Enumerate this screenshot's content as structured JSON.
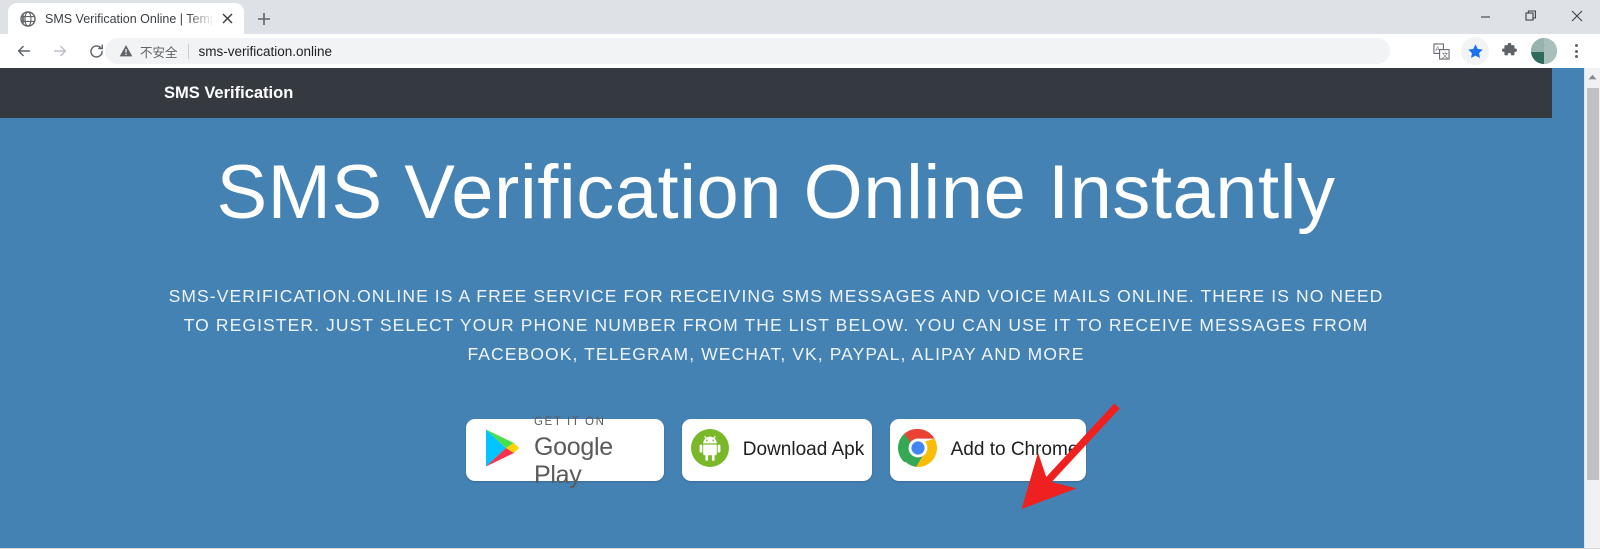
{
  "browser": {
    "tab": {
      "title": "SMS Verification Online | Temp",
      "favicon_icon": "globe-icon",
      "close_icon": "close-icon"
    },
    "new_tab_label": "+",
    "window_controls": {
      "minimize": "minimize-icon",
      "maximize": "restore-icon",
      "close": "close-icon"
    },
    "nav": {
      "back_icon": "back-arrow-icon",
      "forward_icon": "forward-arrow-icon",
      "reload_icon": "reload-icon"
    },
    "omnibox": {
      "security_icon": "warning-triangle-icon",
      "security_text": "不安全",
      "url": "sms-verification.online"
    },
    "toolbar_icons": [
      {
        "name": "translate-icon",
        "label": "译"
      },
      {
        "name": "bookmark-star-icon",
        "label": "★"
      },
      {
        "name": "extensions-puzzle-icon",
        "label": "puzzle"
      },
      {
        "name": "profile-avatar",
        "label": "avatar"
      },
      {
        "name": "chrome-menu-icon",
        "label": "⋮"
      }
    ]
  },
  "site": {
    "navbar": {
      "brand": "SMS Verification"
    },
    "hero": {
      "heading": "SMS Verification Online Instantly",
      "paragraph": "SMS-VERIFICATION.ONLINE IS A FREE SERVICE FOR RECEIVING SMS MESSAGES AND VOICE MAILS ONLINE. THERE IS NO NEED TO REGISTER. JUST SELECT YOUR PHONE NUMBER FROM THE LIST BELOW. YOU CAN USE IT TO RECEIVE MESSAGES FROM FACEBOOK, TELEGRAM, WECHAT, VK, PAYPAL, ALIPAY AND MORE",
      "buttons": {
        "google_play": {
          "small_label": "GET IT ON",
          "big_label": "Google Play",
          "icon": "google-play-icon"
        },
        "download_apk": {
          "label": "Download Apk",
          "icon": "android-icon"
        },
        "add_to_chrome": {
          "label": "Add to Chrome",
          "icon": "chrome-icon"
        }
      }
    }
  },
  "annotation": {
    "arrow_color": "#ef2020",
    "arrow_target": "add-to-chrome-button"
  },
  "colors": {
    "hero_blue": "#4582b4",
    "navbar_dark": "#343a40",
    "tabstrip_gray": "#dee1e6",
    "accent_star": "#1a73e8"
  }
}
